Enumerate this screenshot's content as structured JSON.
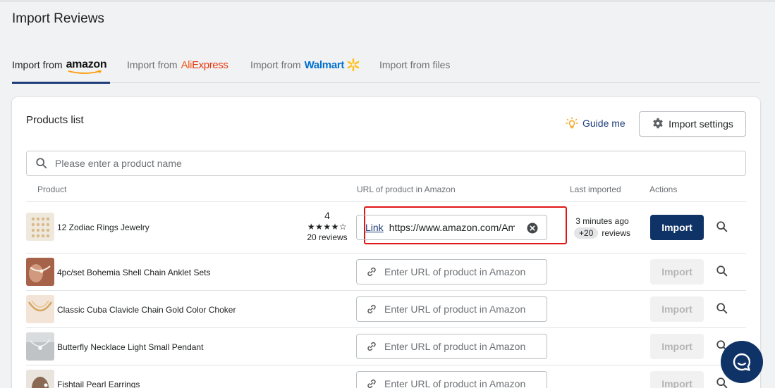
{
  "page": {
    "title": "Import Reviews"
  },
  "tabs": [
    {
      "prefix": "Import from",
      "brand": "amazon"
    },
    {
      "prefix": "Import from",
      "brand_part1": "Ali",
      "brand_part2": "Express"
    },
    {
      "prefix": "Import from",
      "brand": "Walmart"
    },
    {
      "label": "Import from files"
    }
  ],
  "colors": {
    "accent": "#0f3366",
    "tab_underline": "#1f3e7a",
    "highlight": "#e01515",
    "walmart": "#0071ce",
    "walmart_spark": "#ffc220",
    "aliexpress": "#e8380d"
  },
  "card": {
    "title": "Products list",
    "guide_label": "Guide me",
    "settings_label": "Import settings"
  },
  "search": {
    "placeholder": "Please enter a product name"
  },
  "table": {
    "headers": {
      "product": "Product",
      "url": "URL of product in Amazon",
      "last": "Last imported",
      "actions": "Actions"
    },
    "url_placeholder": "Enter URL of product in Amazon",
    "import_label": "Import",
    "rows": [
      {
        "name": "12 Zodiac Rings Jewelry",
        "rating": "4",
        "stars": "★★★★☆",
        "reviews": "20 reviews",
        "link_label": "Link",
        "url_value": "https://www.amazon.com/Amazon-Essentials",
        "last_time": "3 minutes ago",
        "last_badge": "+20",
        "last_suffix": "reviews"
      },
      {
        "name": "4pc/set Bohemia Shell Chain Anklet Sets"
      },
      {
        "name": "Classic Cuba Clavicle Chain Gold Color Choker"
      },
      {
        "name": "Butterfly Necklace Light Small Pendant"
      },
      {
        "name": "Fishtail Pearl Earrings"
      }
    ]
  },
  "icons": [
    "search-icon",
    "lightbulb-icon",
    "gear-icon",
    "link-icon",
    "clear-icon",
    "magnifier-icon",
    "chat-icon"
  ]
}
